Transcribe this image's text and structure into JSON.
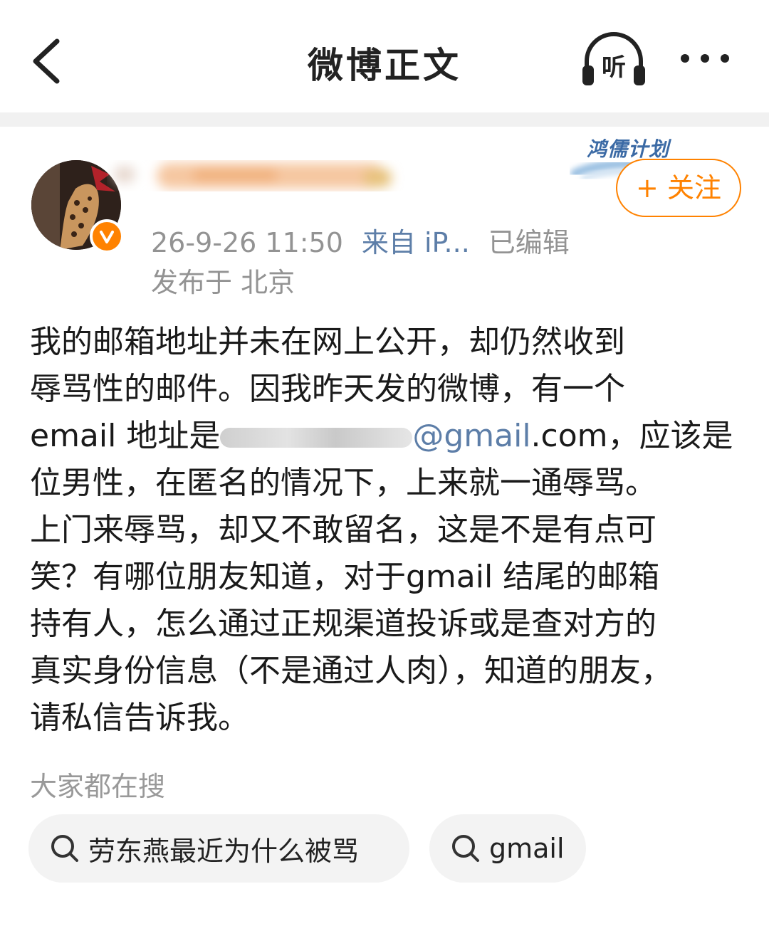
{
  "navbar": {
    "title": "微博正文",
    "listen_label": "听",
    "icons": {
      "back": "chevron-left-icon",
      "listen": "headphones-icon",
      "more": "more-dots-icon"
    }
  },
  "author": {
    "meta": {
      "date": "26-9-26 11:50",
      "source": "来自 iP...",
      "edited": "已编辑"
    },
    "location": "发布于 北京",
    "follow_label": "+ 关注",
    "tag": "鸿儒计划",
    "badge_color": "#ff8200"
  },
  "post": {
    "lines": [
      "我的邮箱地址并未在网上公开，却仍然收到",
      "辱骂性的邮件。因我昨天发的微博，有一个",
      {
        "before": "email 地址是",
        "link": "@gmail",
        "after": ".com，应该是"
      },
      "位男性，在匿名的情况下，上来就一通辱骂。",
      "上门来辱骂，却又不敢留名，这是不是有点可",
      "笑？有哪位朋友知道，对于gmail 结尾的邮箱",
      "持有人，怎么通过正规渠道投诉或是查对方的",
      "真实身份信息（不是通过人肉），知道的朋友，",
      "请私信告诉我。"
    ]
  },
  "search": {
    "title": "大家都在搜",
    "chips": [
      "劳东燕最近为什么被骂",
      "gmail"
    ]
  },
  "colors": {
    "accent": "#ff8200",
    "link": "#5d7ea8",
    "meta": "#939393"
  }
}
